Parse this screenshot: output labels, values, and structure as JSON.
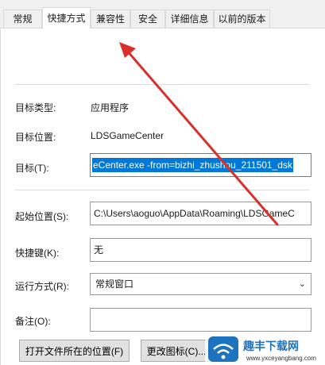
{
  "tabs": [
    {
      "label": "常规",
      "active": false
    },
    {
      "label": "快捷方式",
      "active": true
    },
    {
      "label": "兼容性",
      "active": false
    },
    {
      "label": "安全",
      "active": false
    },
    {
      "label": "详细信息",
      "active": false
    },
    {
      "label": "以前的版本",
      "active": false
    }
  ],
  "info": {
    "target_type_label": "目标类型:",
    "target_type_value": "应用程序",
    "target_location_label": "目标位置:",
    "target_location_value": "LDSGameCenter",
    "target_label": "目标(T):",
    "target_value": "eCenter.exe -from=bizhi_zhushou_211501_dsk"
  },
  "fields": {
    "start_in_label": "起始位置(S):",
    "start_in_value": "C:\\Users\\aoguo\\AppData\\Roaming\\LDSGameC",
    "shortcut_key_label": "快捷键(K):",
    "shortcut_key_value": "无",
    "run_label": "运行方式(R):",
    "run_value": "常规窗口",
    "comment_label": "备注(O):",
    "comment_value": ""
  },
  "buttons": {
    "open_location": "打开文件所在的位置(F)",
    "change_icon": "更改图标(C)..."
  },
  "watermark": {
    "text": "趣丰下载网",
    "url": "www.yxceyangbang.com"
  },
  "colors": {
    "accent": "#0078d7",
    "annotation_arrow": "#d9302c",
    "watermark": "#1e73be"
  }
}
